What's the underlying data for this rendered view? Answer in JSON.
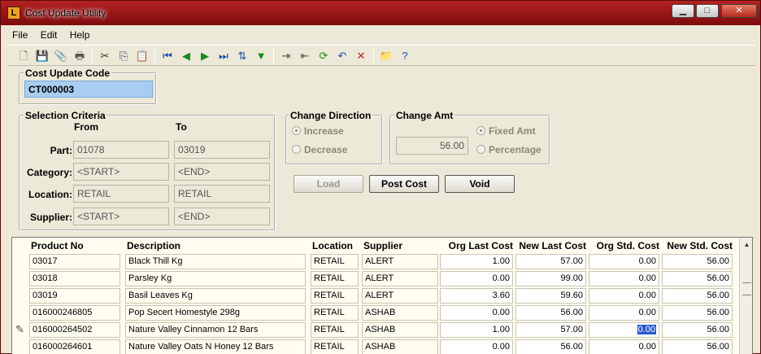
{
  "window": {
    "title": "Cost Update Utility",
    "app_icon_glyph": "L",
    "controls": {
      "minimize": "▁",
      "maximize": "□",
      "close": "✕"
    }
  },
  "menu": [
    "File",
    "Edit",
    "Help"
  ],
  "toolbar": [
    {
      "name": "new-icon",
      "glyph": "🗋",
      "color": "#2a7a2a"
    },
    {
      "name": "save-icon",
      "glyph": "💾",
      "color": "#2a4a8a"
    },
    {
      "name": "attach-icon",
      "glyph": "📎",
      "color": "#666666"
    },
    {
      "name": "print-icon",
      "glyph": "🖶",
      "color": "#555555"
    },
    {
      "sep": true
    },
    {
      "name": "cut-icon",
      "glyph": "✂",
      "color": "#333333"
    },
    {
      "name": "copy-icon",
      "glyph": "⎘",
      "color": "#2a4a8a"
    },
    {
      "name": "paste-icon",
      "glyph": "📋",
      "color": "#8a6a2a"
    },
    {
      "sep": true
    },
    {
      "name": "first-record-icon",
      "glyph": "⏮",
      "color": "#1a4ab0"
    },
    {
      "name": "previous-record-icon",
      "glyph": "◀",
      "color": "#1a8a1a"
    },
    {
      "name": "next-record-icon",
      "glyph": "▶",
      "color": "#1a8a1a"
    },
    {
      "name": "last-record-icon",
      "glyph": "⏭",
      "color": "#1a4ab0"
    },
    {
      "name": "sort-icon",
      "glyph": "⇅",
      "color": "#1a4ab0"
    },
    {
      "name": "filter-icon",
      "glyph": "▼",
      "color": "#1a8a1a"
    },
    {
      "sep": true
    },
    {
      "name": "insert-row-icon",
      "glyph": "⇥",
      "color": "#555555"
    },
    {
      "name": "append-row-icon",
      "glyph": "⇤",
      "color": "#555555"
    },
    {
      "name": "refresh-icon",
      "glyph": "⟳",
      "color": "#1a8a1a"
    },
    {
      "name": "undo-icon",
      "glyph": "↶",
      "color": "#1a4ab0"
    },
    {
      "name": "delete-icon",
      "glyph": "✕",
      "color": "#c81a1a"
    },
    {
      "sep": true
    },
    {
      "name": "open-folder-icon",
      "glyph": "📁",
      "color": "#c89a1a"
    },
    {
      "name": "help-icon",
      "glyph": "?",
      "color": "#1a4ab0"
    }
  ],
  "cost_update_code": {
    "title": "Cost Update Code",
    "value": "CT000003"
  },
  "selection": {
    "title": "Selection Criteria",
    "from_label": "From",
    "to_label": "To",
    "rows": [
      {
        "label": "Part:",
        "from": "01078",
        "to": "03019"
      },
      {
        "label": "Category:",
        "from": "<START>",
        "to": "<END>"
      },
      {
        "label": "Location:",
        "from": "RETAIL",
        "to": "RETAIL"
      },
      {
        "label": "Supplier:",
        "from": "<START>",
        "to": "<END>"
      }
    ]
  },
  "change_direction": {
    "title": "Change Direction",
    "options": [
      "Increase",
      "Decrease"
    ],
    "selected": "Increase"
  },
  "change_amt": {
    "title": "Change Amt",
    "value": "56.00",
    "options": [
      "Fixed Amt",
      "Percentage"
    ],
    "selected": "Fixed Amt"
  },
  "buttons": {
    "load": "Load",
    "post_cost": "Post Cost",
    "void": "Void"
  },
  "grid": {
    "columns": [
      "Product No",
      "Description",
      "Location",
      "Supplier",
      "Org Last Cost",
      "New Last Cost",
      "Org Std. Cost",
      "New Std. Cost"
    ],
    "rows": [
      [
        "03017",
        "Black Thill Kg",
        "RETAIL",
        "ALERT",
        "1.00",
        "57.00",
        "0.00",
        "56.00"
      ],
      [
        "03018",
        "Parsley Kg",
        "RETAIL",
        "ALERT",
        "0.00",
        "99.00",
        "0.00",
        "56.00"
      ],
      [
        "03019",
        "Basil Leaves Kg",
        "RETAIL",
        "ALERT",
        "3.60",
        "59.60",
        "0.00",
        "56.00"
      ],
      [
        "016000246805",
        "Pop Secert Homestyle 298g",
        "RETAIL",
        "ASHAB",
        "0.00",
        "56.00",
        "0.00",
        "56.00"
      ],
      [
        "016000264502",
        "Nature Valley Cinnamon 12 Bars",
        "RETAIL",
        "ASHAB",
        "1.00",
        "57.00",
        "0.00",
        "56.00"
      ],
      [
        "016000264601",
        "Nature Valley Oats N Honey 12 Bars",
        "RETAIL",
        "ASHAB",
        "0.00",
        "56.00",
        "0.00",
        "56.00"
      ]
    ],
    "current_row": 4,
    "current_col": 6
  }
}
